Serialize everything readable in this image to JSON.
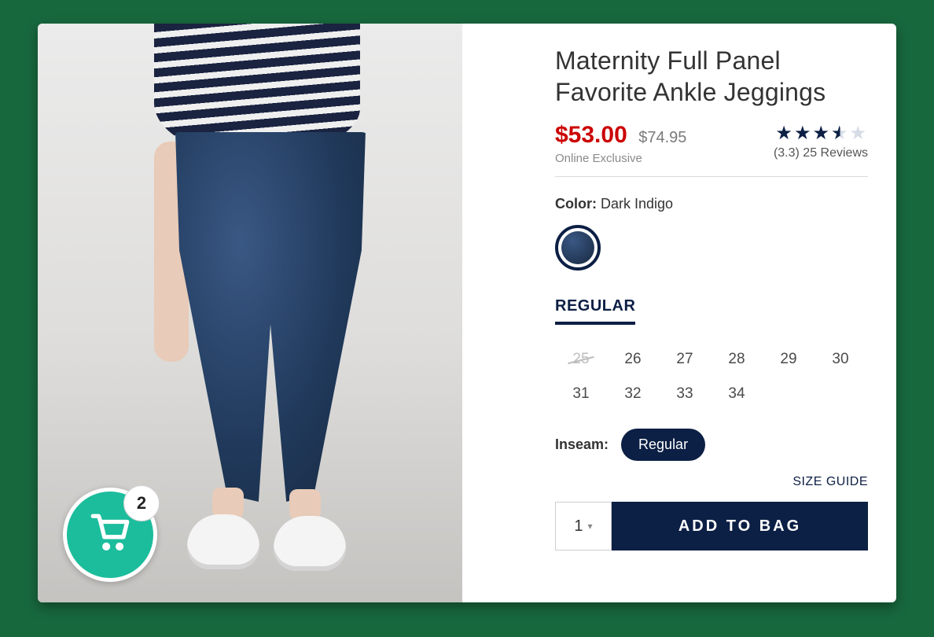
{
  "product": {
    "title": "Maternity Full Panel Favorite Ankle Jeggings",
    "sale_price": "$53.00",
    "original_price": "$74.95",
    "price_note": "Online Exclusive"
  },
  "reviews": {
    "stars_filled": 3,
    "stars_half": 1,
    "stars_empty": 1,
    "summary": "(3.3) 25 Reviews"
  },
  "color": {
    "label": "Color:",
    "value": "Dark Indigo",
    "swatch_hex": "#1e3355"
  },
  "fit_tab": "REGULAR",
  "sizes": [
    {
      "label": "25",
      "available": false
    },
    {
      "label": "26",
      "available": true
    },
    {
      "label": "27",
      "available": true
    },
    {
      "label": "28",
      "available": true
    },
    {
      "label": "29",
      "available": true
    },
    {
      "label": "30",
      "available": true
    },
    {
      "label": "31",
      "available": true
    },
    {
      "label": "32",
      "available": true
    },
    {
      "label": "33",
      "available": true
    },
    {
      "label": "34",
      "available": true
    }
  ],
  "inseam": {
    "label": "Inseam:",
    "selected": "Regular"
  },
  "size_guide": "SIZE GUIDE",
  "cta": {
    "qty": "1",
    "add_label": "ADD TO BAG"
  },
  "cart": {
    "count": "2"
  },
  "colors": {
    "accent": "#0c1f44",
    "sale": "#cc0404",
    "fab": "#1bbd9c"
  }
}
